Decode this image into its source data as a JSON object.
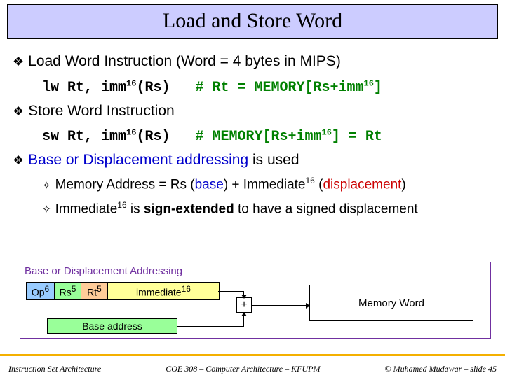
{
  "title": "Load and Store Word",
  "b1": {
    "text": "Load Word Instruction (Word = 4 bytes in MIPS)",
    "code_left": "lw Rt, imm",
    "code_sup": "16",
    "code_mid": "(Rs)",
    "comment_a": "# Rt = MEMORY[Rs+imm",
    "comment_sup": "16",
    "comment_b": "]"
  },
  "b2": {
    "text": "Store Word Instruction",
    "code_left": "sw Rt, imm",
    "code_sup": "16",
    "code_mid": "(Rs)",
    "comment_a": "# MEMORY[Rs+imm",
    "comment_sup": "16",
    "comment_b": "] = Rt"
  },
  "b3": {
    "text_a": "Base or Displacement addressing",
    "text_b": " is used",
    "s1_a": "Memory Address = Rs (",
    "s1_b": "base",
    "s1_c": ") + Immediate",
    "s1_sup": "16",
    "s1_d": " (",
    "s1_e": "displacement",
    "s1_f": ")",
    "s2_a": "Immediate",
    "s2_sup": "16",
    "s2_b": " is ",
    "s2_c": "sign-extended",
    "s2_d": " to have a signed displacement"
  },
  "diagram": {
    "title": "Base or Displacement Addressing",
    "op": "Op",
    "op_sup": "6",
    "rs": "Rs",
    "rs_sup": "5",
    "rt": "Rt",
    "rt_sup": "5",
    "imm": "immediate",
    "imm_sup": "16",
    "plus": "+",
    "base": "Base address",
    "mem": "Memory Word"
  },
  "footer": {
    "left": "Instruction Set Architecture",
    "center": "COE 308 – Computer Architecture – KFUPM",
    "right": "© Muhamed Mudawar – slide 45"
  },
  "bullets": {
    "l1": "❖",
    "l2": "✧"
  }
}
